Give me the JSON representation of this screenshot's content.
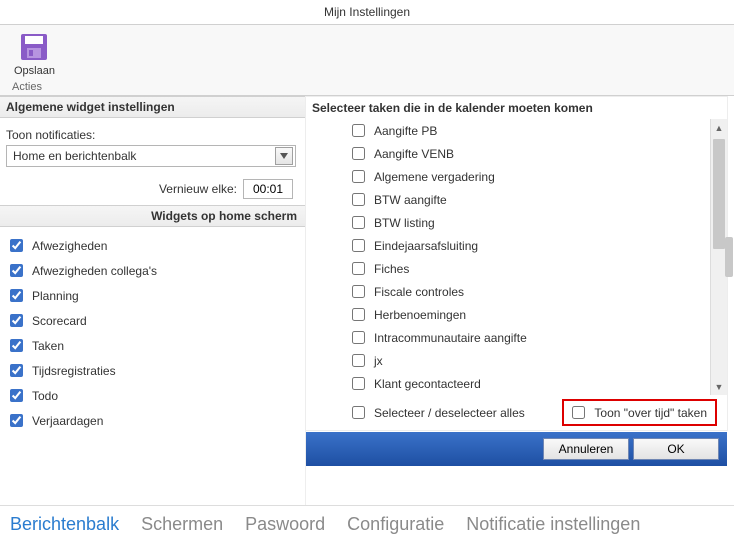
{
  "window": {
    "title": "Mijn Instellingen"
  },
  "ribbon": {
    "save_label": "Opslaan",
    "section_label": "Acties"
  },
  "left": {
    "general_header": "Algemene widget instellingen",
    "notify_label": "Toon notificaties:",
    "dropdown_value": "Home en berichtenbalk",
    "refresh_label": "Vernieuw elke:",
    "refresh_value": "00:01",
    "widgets_header": "Widgets op home scherm",
    "widgets": [
      {
        "label": "Afwezigheden",
        "checked": true
      },
      {
        "label": "Afwezigheden collega's",
        "checked": true
      },
      {
        "label": "Planning",
        "checked": true
      },
      {
        "label": "Scorecard",
        "checked": true
      },
      {
        "label": "Taken",
        "checked": true
      },
      {
        "label": "Tijdsregistraties",
        "checked": true
      },
      {
        "label": "Todo",
        "checked": true
      },
      {
        "label": "Verjaardagen",
        "checked": true
      }
    ]
  },
  "dialog": {
    "title": "Selecteer taken die in de kalender moeten komen",
    "tasks": [
      {
        "label": "Aangifte PB"
      },
      {
        "label": "Aangifte VENB"
      },
      {
        "label": "Algemene vergadering"
      },
      {
        "label": "BTW aangifte"
      },
      {
        "label": "BTW listing"
      },
      {
        "label": "Eindejaarsafsluiting"
      },
      {
        "label": "Fiches"
      },
      {
        "label": "Fiscale controles"
      },
      {
        "label": "Herbenoemingen"
      },
      {
        "label": "Intracommunautaire aangifte"
      },
      {
        "label": "jx"
      },
      {
        "label": "Klant gecontacteerd"
      }
    ],
    "select_all_label": "Selecteer / deselecteer alles",
    "overdue_label": "Toon \"over tijd\" taken",
    "cancel_label": "Annuleren",
    "ok_label": "OK"
  },
  "tabs": [
    {
      "label": "Berichtenbalk",
      "active": true
    },
    {
      "label": "Schermen"
    },
    {
      "label": "Paswoord"
    },
    {
      "label": "Configuratie"
    },
    {
      "label": "Notificatie instellingen"
    }
  ]
}
